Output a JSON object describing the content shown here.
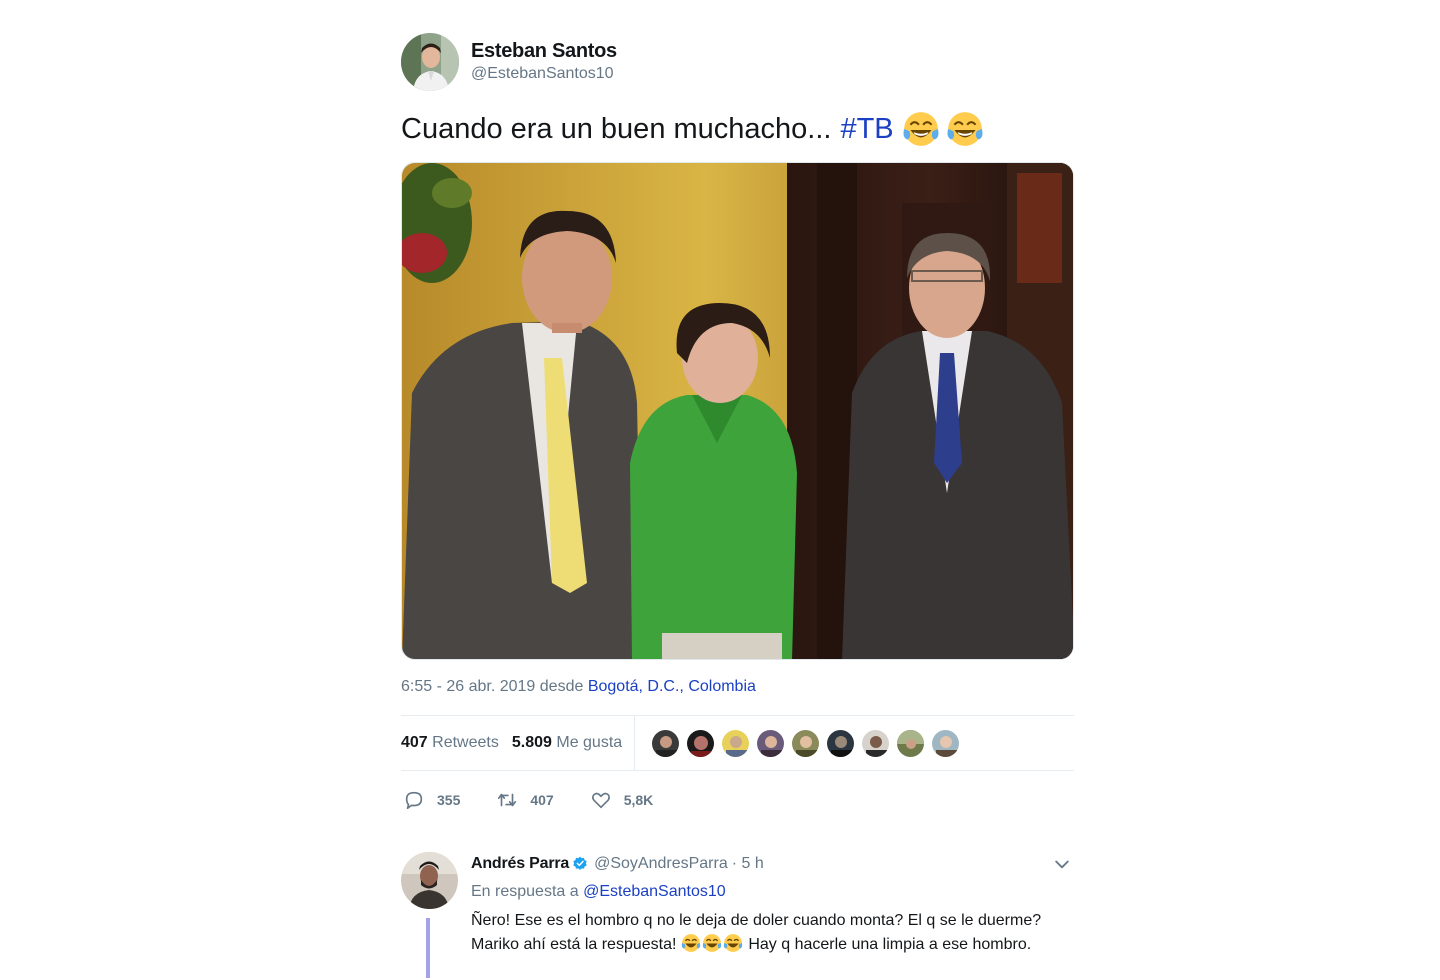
{
  "tweet": {
    "author": {
      "name": "Esteban Santos",
      "handle": "@EstebanSantos10"
    },
    "text": "Cuando era un buen muchacho...",
    "hashtag": "#TB",
    "emoji": [
      "face-with-tears-of-joy",
      "face-with-tears-of-joy"
    ],
    "meta": {
      "time": "6:55 - 26 abr. 2019 desde",
      "location": "Bogotá, D.C., Colombia"
    },
    "stats": {
      "retweets_count": "407",
      "retweets_label": "Retweets",
      "likes_count": "5.809",
      "likes_label": "Me gusta"
    },
    "likers_count_shown": 9,
    "actions": {
      "replies": "355",
      "retweets": "407",
      "likes": "5,8K"
    }
  },
  "reply": {
    "name": "Andrés Parra",
    "verified": true,
    "handle": "@SoyAndresParra",
    "time": "· 5 h",
    "in_reply_prefix": "En respuesta a",
    "in_reply_handle": "@EstebanSantos10",
    "line1": "Ñero! Ese es el hombro q no le deja de doler cuando monta? El q se le duerme?",
    "line2_a": "Mariko ahí está la respuesta!",
    "line2_b": "Hay q hacerle una limpia a ese hombro."
  },
  "colors": {
    "link": "#1b40c4",
    "secondary": "#657786",
    "thread_line": "#a4a2e8",
    "verified": "#1da1f2"
  }
}
